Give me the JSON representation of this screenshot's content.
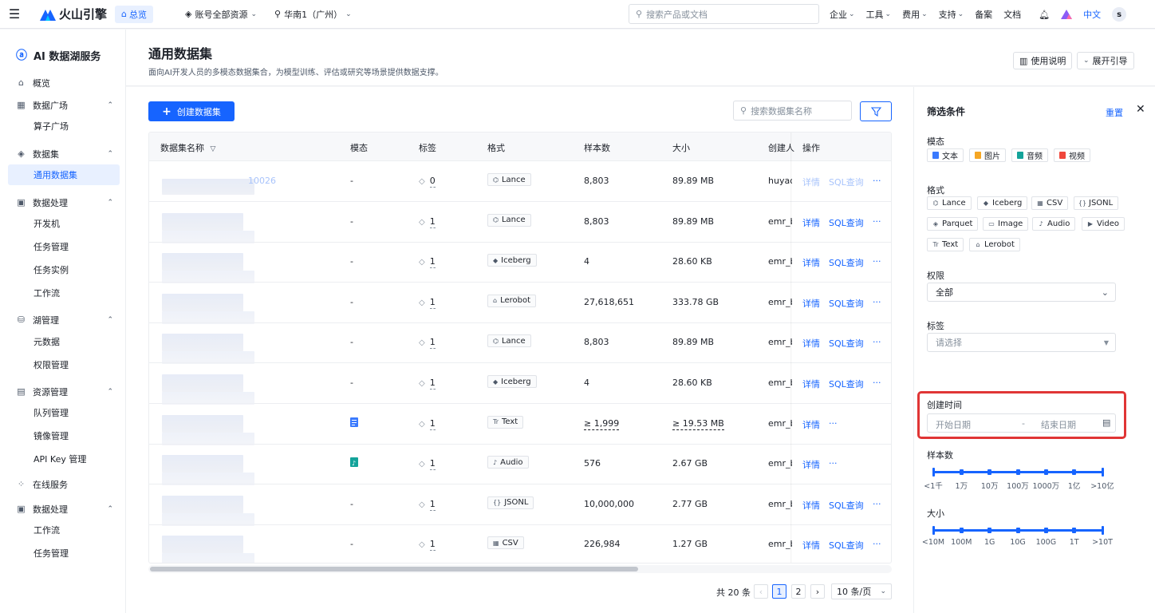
{
  "topbar": {
    "brand": "火山引擎",
    "home": "总览",
    "account_scope": "账号全部资源",
    "region": "华南1（广州）",
    "search_placeholder": "搜索产品或文档",
    "menu": [
      "企业",
      "工具",
      "费用",
      "支持",
      "备案",
      "文档"
    ],
    "lang": "中文",
    "avatar": "s"
  },
  "sidebar": {
    "title": "AI 数据湖服务",
    "overview": "概览",
    "groups": [
      {
        "label": "数据广场",
        "items": [
          "算子广场"
        ]
      },
      {
        "label": "数据集",
        "items": [
          "通用数据集"
        ]
      },
      {
        "label": "数据处理",
        "items": [
          "开发机",
          "任务管理",
          "任务实例",
          "工作流"
        ]
      },
      {
        "label": "湖管理",
        "items": [
          "元数据",
          "权限管理"
        ]
      },
      {
        "label": "资源管理",
        "items": [
          "队列管理",
          "镜像管理",
          "API Key 管理"
        ]
      },
      {
        "label": "在线服务",
        "items": []
      },
      {
        "label": "数据处理",
        "items": [
          "工作流",
          "任务管理"
        ]
      }
    ],
    "active_item": "通用数据集"
  },
  "page": {
    "title": "通用数据集",
    "subtitle": "面向AI开发人员的多模态数据集合，为模型训练、评估或研究等场景提供数据支撑。",
    "help_btn": "使用说明",
    "guide_btn": "展开引导",
    "create_btn": "创建数据集",
    "search_placeholder": "搜索数据集名称"
  },
  "table": {
    "columns": [
      "数据集名称",
      "模态",
      "标签",
      "格式",
      "样本数",
      "大小",
      "创建人",
      "操作"
    ],
    "rows": [
      {
        "name_suffix": "10026",
        "modal": "-",
        "tags": "0",
        "format": "Lance",
        "samples": "8,803",
        "size": "89.89 MB",
        "creator": "huyao",
        "detail": "详情",
        "sql": "SQL查询",
        "more": "···",
        "disabled": true
      },
      {
        "modal": "-",
        "tags": "1",
        "format": "Lance",
        "samples": "8,803",
        "size": "89.89 MB",
        "creator": "emr_b",
        "detail": "详情",
        "sql": "SQL查询",
        "more": "···"
      },
      {
        "modal": "-",
        "tags": "1",
        "format": "Iceberg",
        "samples": "4",
        "size": "28.60 KB",
        "creator": "emr_b",
        "detail": "详情",
        "sql": "SQL查询",
        "more": "···"
      },
      {
        "modal": "-",
        "tags": "1",
        "format": "Lerobot",
        "samples": "27,618,651",
        "size": "333.78 GB",
        "creator": "emr_b",
        "detail": "详情",
        "sql": "SQL查询",
        "more": "···"
      },
      {
        "modal": "-",
        "tags": "1",
        "format": "Lance",
        "samples": "8,803",
        "size": "89.89 MB",
        "creator": "emr_b",
        "detail": "详情",
        "sql": "SQL查询",
        "more": "···"
      },
      {
        "modal": "-",
        "tags": "1",
        "format": "Iceberg",
        "samples": "4",
        "size": "28.60 KB",
        "creator": "emr_b",
        "detail": "详情",
        "sql": "SQL查询",
        "more": "···"
      },
      {
        "modal": "text-icon",
        "tags": "1",
        "format": "Text",
        "samples": "≥ 1,999",
        "size": "≥ 19.53 MB",
        "creator": "emr_b",
        "detail": "详情",
        "sql": "",
        "more": "···"
      },
      {
        "modal": "audio-icon",
        "tags": "1",
        "format": "Audio",
        "samples": "576",
        "size": "2.67 GB",
        "creator": "emr_b",
        "detail": "详情",
        "sql": "",
        "more": "···"
      },
      {
        "modal": "-",
        "tags": "1",
        "format": "JSONL",
        "samples": "10,000,000",
        "size": "2.77 GB",
        "creator": "emr_b",
        "detail": "详情",
        "sql": "SQL查询",
        "more": "···"
      },
      {
        "modal": "-",
        "tags": "1",
        "format": "CSV",
        "samples": "226,984",
        "size": "1.27 GB",
        "creator": "emr_b",
        "detail": "详情",
        "sql": "SQL查询",
        "more": "···"
      }
    ]
  },
  "pagination": {
    "total": "共 20 条",
    "prev": "‹",
    "pages": [
      "1",
      "2"
    ],
    "current": "1",
    "next": "›",
    "page_size": "10 条/页"
  },
  "filter": {
    "title": "筛选条件",
    "reset": "重置",
    "close": "✕",
    "modality_label": "模态",
    "modalities": [
      "文本",
      "图片",
      "音频",
      "视频"
    ],
    "format_label": "格式",
    "formats": [
      "Lance",
      "Iceberg",
      "CSV",
      "JSONL",
      "Parquet",
      "Image",
      "Audio",
      "Video",
      "Text",
      "Lerobot"
    ],
    "permission_label": "权限",
    "permission_value": "全部",
    "tag_label": "标签",
    "tag_placeholder": "请选择",
    "created_label": "创建时间",
    "start_placeholder": "开始日期",
    "date_sep": "-",
    "end_placeholder": "结束日期",
    "samples_label": "样本数",
    "samples_ticks": [
      "<1千",
      "1万",
      "10万",
      "100万",
      "1000万",
      "1亿",
      ">10亿"
    ],
    "size_label": "大小",
    "size_ticks": [
      "<10M",
      "100M",
      "1G",
      "10G",
      "100G",
      "1T",
      ">10T"
    ]
  },
  "colors": {
    "accent": "#1664ff",
    "highlight": "#e03535"
  }
}
